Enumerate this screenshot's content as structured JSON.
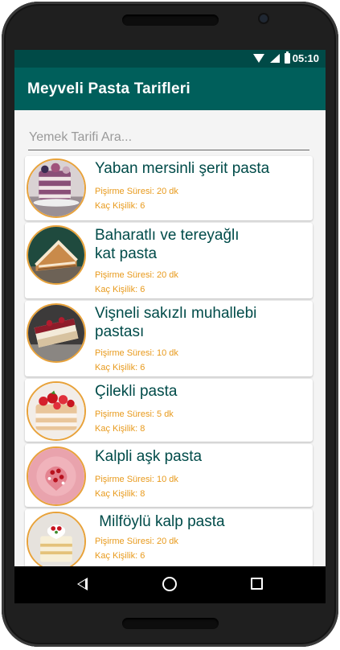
{
  "status_bar": {
    "time": "05:10"
  },
  "app_bar": {
    "title": "Meyveli Pasta Tarifleri"
  },
  "search": {
    "placeholder": "Yemek Tarifi Ara..."
  },
  "recipes": [
    {
      "title": "Yaban mersinli şerit pasta",
      "cook_time": "Pişirme Süresi: 20 dk",
      "servings": "Kaç Kişilik: 6"
    },
    {
      "title": "Baharatlı ve tereyağlı\nkat pasta",
      "cook_time": "Pişirme Süresi: 20 dk",
      "servings": "Kaç Kişilik: 6"
    },
    {
      "title": "Vişneli sakızlı muhallebi\npastası",
      "cook_time": "Pişirme Süresi: 10 dk",
      "servings": "Kaç Kişilik: 6"
    },
    {
      "title": "Çilekli pasta",
      "cook_time": "Pişirme Süresi: 5 dk",
      "servings": "Kaç Kişilik: 8"
    },
    {
      "title": "Kalpli aşk pasta",
      "cook_time": "Pişirme Süresi: 10 dk",
      "servings": "Kaç Kişilik: 8"
    },
    {
      "title": " Milföylü kalp pasta",
      "cook_time": "Pişirme Süresi: 20 dk",
      "servings": "Kaç Kişilik: 6"
    }
  ],
  "nav_bar": {
    "back": "back-icon",
    "home": "home-icon",
    "recents": "recents-icon"
  }
}
